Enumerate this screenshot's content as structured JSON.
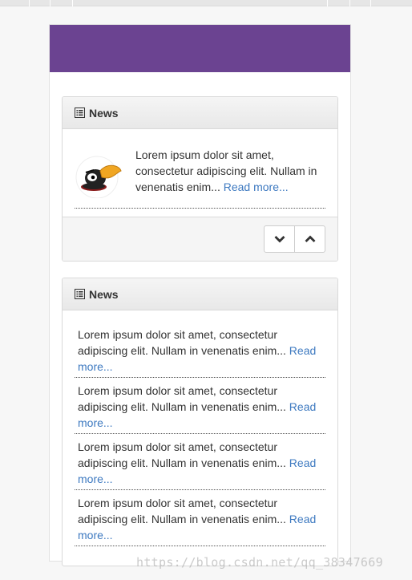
{
  "panel1": {
    "title": "News",
    "item": {
      "text": "Lorem ipsum dolor sit amet, consectetur adipiscing elit. Nullam in venenatis enim...",
      "read_more": "Read more..."
    }
  },
  "panel2": {
    "title": "News",
    "items": [
      {
        "text": "Lorem ipsum dolor sit amet, consectetur adipiscing elit. Nullam in venenatis enim...",
        "read_more": "Read more..."
      },
      {
        "text": "Lorem ipsum dolor sit amet, consectetur adipiscing elit. Nullam in venenatis enim...",
        "read_more": "Read more..."
      },
      {
        "text": "Lorem ipsum dolor sit amet, consectetur adipiscing elit. Nullam in venenatis enim...",
        "read_more": "Read more..."
      },
      {
        "text": "Lorem ipsum dolor sit amet, consectetur adipiscing elit. Nullam in venenatis enim...",
        "read_more": "Read more..."
      }
    ]
  },
  "footer_buttons": [
    "chevron-down-icon",
    "chevron-up-icon"
  ],
  "watermark": "https://blog.csdn.net/qq_38347669",
  "colors": {
    "header": "#6b4391",
    "link": "#3d79c0"
  }
}
